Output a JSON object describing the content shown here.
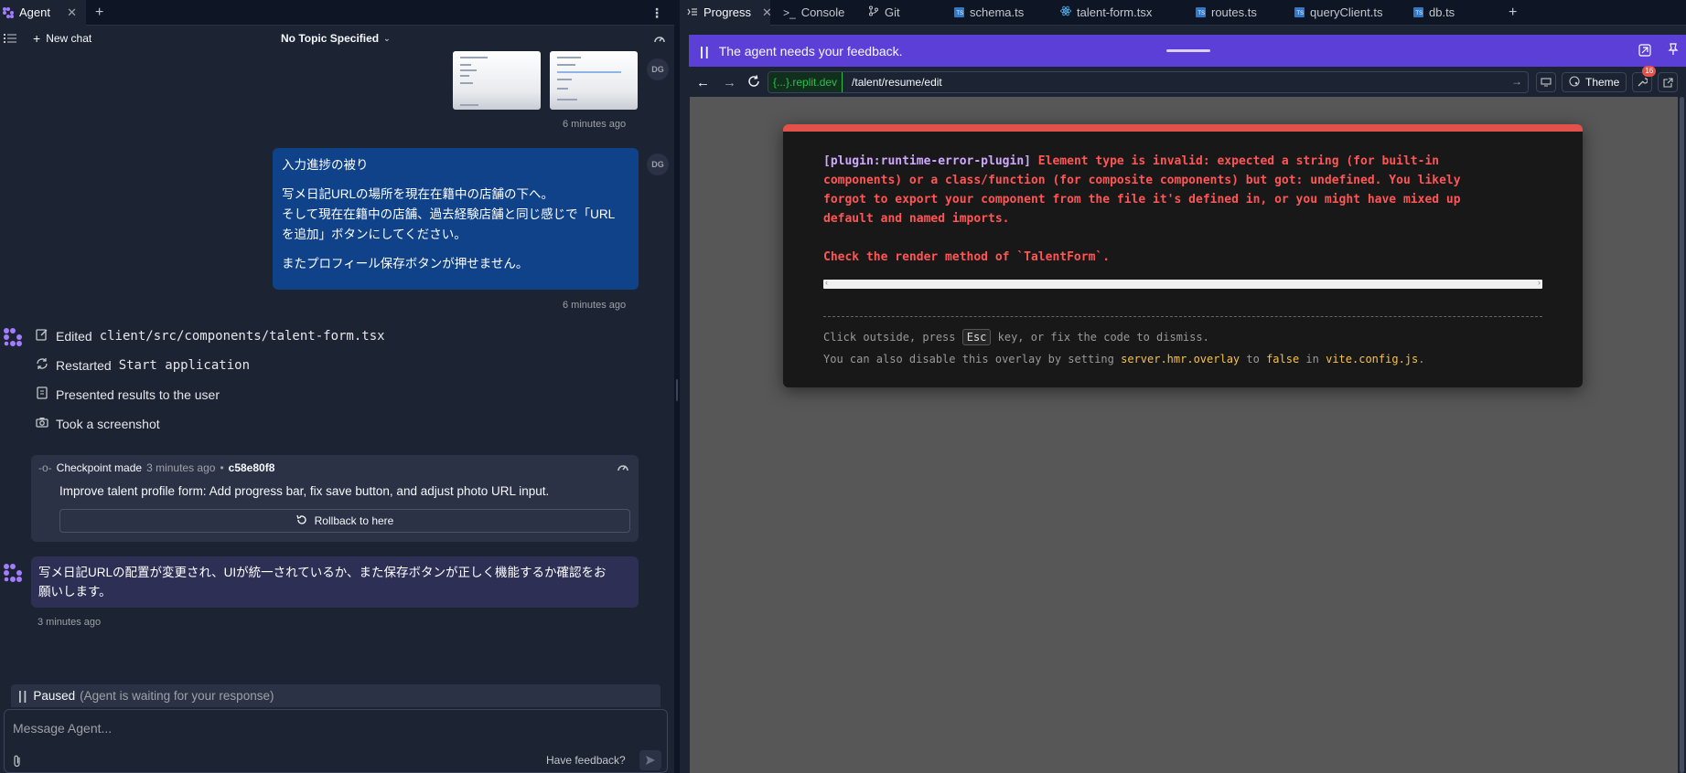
{
  "left_panel": {
    "tab_label": "Agent",
    "new_chat": "New chat",
    "topic": "No Topic Specified",
    "user_initials": "DG",
    "time_1": "6 minutes ago",
    "user_message": {
      "line1": "入力進捗の被り",
      "line2": "写メ日記URLの場所を現在在籍中の店舗の下へ。",
      "line3": "そして現在在籍中の店舗、過去経験店舗と同じ感じで「URL",
      "line4": "を追加」ボタンにしてください。",
      "line5": "またプロフィール保存ボタンが押せません。"
    },
    "time_2": "6 minutes ago",
    "actions": [
      {
        "prefix": "Edited",
        "code": "client/src/components/talent-form.tsx"
      },
      {
        "prefix": "Restarted",
        "code": "Start application"
      },
      {
        "prefix": "Presented results to the user",
        "code": ""
      },
      {
        "prefix": "Took a screenshot",
        "code": ""
      }
    ],
    "checkpoint": {
      "label": "Checkpoint made",
      "time": "3 minutes ago",
      "sep": "•",
      "hash": "c58e80f8",
      "description": "Improve talent profile form: Add progress bar, fix save button, and adjust photo URL input.",
      "rollback": "Rollback to here"
    },
    "agent_message": {
      "line1": "写メ日記URLの配置が変更され、UIが統一されているか、また保存ボタンが正しく機能するか確認をお",
      "line2": "願いします。"
    },
    "time_3": "3 minutes ago",
    "paused_label": "Paused",
    "paused_detail": "(Agent is waiting for your response)",
    "composer_placeholder": "Message Agent...",
    "feedback_link": "Have feedback?"
  },
  "right_panel": {
    "tabs": [
      {
        "label": "Progress",
        "icon": "progress-icon",
        "active": true
      },
      {
        "label": "Console",
        "icon": "console-icon"
      },
      {
        "label": "Git",
        "icon": "git-icon"
      },
      {
        "label": "schema.ts",
        "icon": "ts-file-icon"
      },
      {
        "label": "talent-form.tsx",
        "icon": "react-file-icon"
      },
      {
        "label": "routes.ts",
        "icon": "ts-file-icon"
      },
      {
        "label": "queryClient.ts",
        "icon": "ts-file-icon"
      },
      {
        "label": "db.ts",
        "icon": "ts-file-icon"
      }
    ],
    "feedback_banner": "The agent needs your feedback.",
    "url_domain": "{...}.replit.dev",
    "url_path": "/talent/resume/edit",
    "theme_label": "Theme",
    "devtools_badge": "16",
    "error": {
      "plugin": "[plugin:runtime-error-plugin]",
      "line1": " Element type is invalid: expected a string (for built-in",
      "line2": "components) or a class/function (for composite components) but got: undefined. You likely",
      "line3": "forgot to export your component from the file it's defined in, or you might have mixed up",
      "line4": "default and named imports.",
      "line5": "Check the render method of `TalentForm`.",
      "tip1_a": "Click outside, press ",
      "tip1_key": "Esc",
      "tip1_b": " key, or fix the code to dismiss.",
      "tip2_a": "You can also disable this overlay by setting ",
      "tip2_setting": "server.hmr.overlay",
      "tip2_b": " to ",
      "tip2_false": "false",
      "tip2_c": " in ",
      "tip2_file": "vite.config.js",
      "tip2_d": "."
    }
  },
  "colors": {
    "background": "#1c2333",
    "feedback_banner": "#5c3fd6",
    "user_bubble": "#0f4289",
    "agent_bubble": "#2d2f55",
    "error": "#ff5555",
    "accent_green": "#2ebd4f"
  }
}
